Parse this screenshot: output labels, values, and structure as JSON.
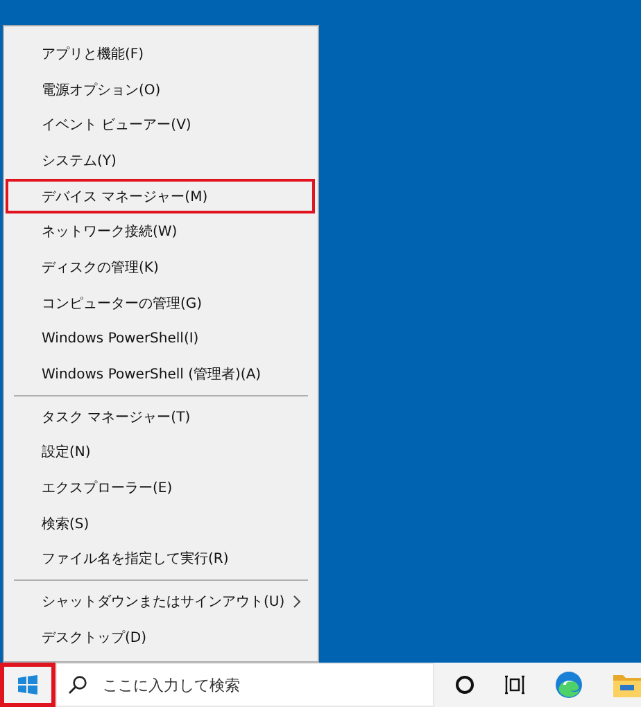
{
  "menu": {
    "groups": [
      {
        "items": [
          {
            "label": "アプリと機能(F)",
            "highlighted": false,
            "submenu": false
          },
          {
            "label": "電源オプション(O)",
            "highlighted": false,
            "submenu": false
          },
          {
            "label": "イベント ビューアー(V)",
            "highlighted": false,
            "submenu": false
          },
          {
            "label": "システム(Y)",
            "highlighted": false,
            "submenu": false
          },
          {
            "label": "デバイス マネージャー(M)",
            "highlighted": true,
            "submenu": false
          },
          {
            "label": "ネットワーク接続(W)",
            "highlighted": false,
            "submenu": false
          },
          {
            "label": "ディスクの管理(K)",
            "highlighted": false,
            "submenu": false
          },
          {
            "label": "コンピューターの管理(G)",
            "highlighted": false,
            "submenu": false
          },
          {
            "label": "Windows PowerShell(I)",
            "highlighted": false,
            "submenu": false
          },
          {
            "label": "Windows PowerShell (管理者)(A)",
            "highlighted": false,
            "submenu": false
          }
        ]
      },
      {
        "items": [
          {
            "label": "タスク マネージャー(T)",
            "highlighted": false,
            "submenu": false
          },
          {
            "label": "設定(N)",
            "highlighted": false,
            "submenu": false
          },
          {
            "label": "エクスプローラー(E)",
            "highlighted": false,
            "submenu": false
          },
          {
            "label": "検索(S)",
            "highlighted": false,
            "submenu": false
          },
          {
            "label": "ファイル名を指定して実行(R)",
            "highlighted": false,
            "submenu": false
          }
        ]
      },
      {
        "items": [
          {
            "label": "シャットダウンまたはサインアウト(U)",
            "highlighted": false,
            "submenu": true
          },
          {
            "label": "デスクトップ(D)",
            "highlighted": false,
            "submenu": false
          }
        ]
      }
    ]
  },
  "taskbar": {
    "start_button": {
      "highlighted": true
    },
    "search": {
      "placeholder": "ここに入力して検索"
    }
  }
}
